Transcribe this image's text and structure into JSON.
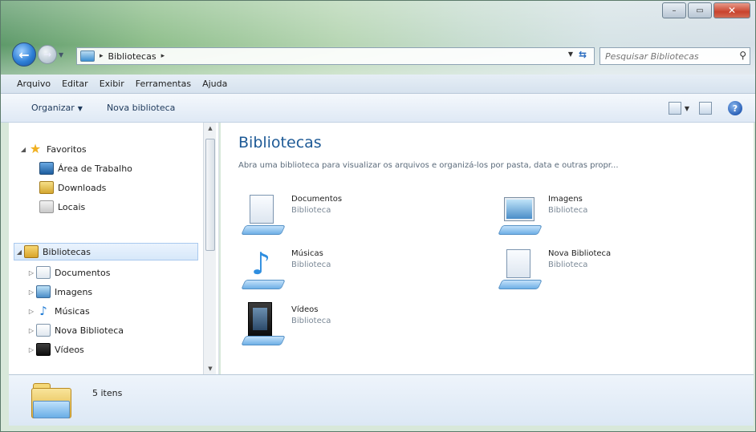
{
  "window": {
    "caption_buttons": {
      "minimize": "–",
      "maximize": "▭",
      "close": "✕"
    }
  },
  "navigation": {
    "back_icon": "back-arrow-icon",
    "forward_icon": "forward-arrow-icon"
  },
  "address_bar": {
    "breadcrumbs": [
      "Bibliotecas"
    ],
    "separator": "▸"
  },
  "search": {
    "placeholder": "Pesquisar Bibliotecas"
  },
  "menu": {
    "items": [
      "Arquivo",
      "Editar",
      "Exibir",
      "Ferramentas",
      "Ajuda"
    ]
  },
  "command_bar": {
    "organize_label": "Organizar",
    "new_library_label": "Nova biblioteca"
  },
  "nav_pane": {
    "favorites": {
      "label": "Favoritos",
      "items": [
        "Área de Trabalho",
        "Downloads",
        "Locais"
      ]
    },
    "libraries": {
      "label": "Bibliotecas",
      "items": [
        "Documentos",
        "Imagens",
        "Músicas",
        "Nova Biblioteca",
        "Vídeos"
      ]
    }
  },
  "content": {
    "title": "Bibliotecas",
    "description": "Abra uma biblioteca para visualizar os arquivos e organizá-los por pasta, data e outras propr...",
    "libraries": [
      {
        "name": "Documentos",
        "type": "Biblioteca",
        "icon": "documents-library-icon"
      },
      {
        "name": "Imagens",
        "type": "Biblioteca",
        "icon": "pictures-library-icon"
      },
      {
        "name": "Músicas",
        "type": "Biblioteca",
        "icon": "music-library-icon"
      },
      {
        "name": "Nova Biblioteca",
        "type": "Biblioteca",
        "icon": "new-library-icon"
      },
      {
        "name": "Vídeos",
        "type": "Biblioteca",
        "icon": "videos-library-icon"
      }
    ]
  },
  "details": {
    "count": "5 itens"
  }
}
